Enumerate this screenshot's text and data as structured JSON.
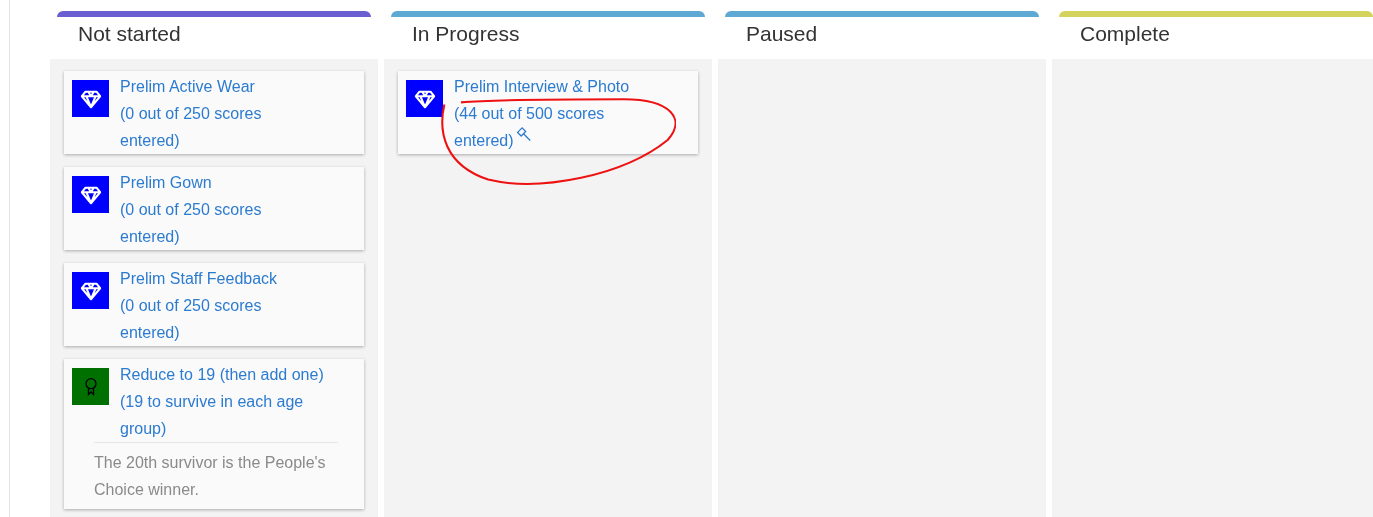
{
  "columns": [
    {
      "title": "Not started",
      "color": "#6a5fd0",
      "cards": [
        {
          "kind": "diamond",
          "title": "Prelim Active Wear",
          "detail": "(0 out of 250 scores entered)",
          "editing": false,
          "circled": false
        },
        {
          "kind": "diamond",
          "title": "Prelim Gown",
          "detail": "(0 out of 250 scores entered)",
          "editing": false,
          "circled": false
        },
        {
          "kind": "diamond",
          "title": "Prelim Staff Feedback",
          "detail": "(0 out of 250 scores entered)",
          "editing": false,
          "circled": false
        },
        {
          "kind": "award",
          "title": "Reduce to 19 (then add one) (19 to survive in each age group)",
          "note": "The 20th survivor is the People's Choice winner.",
          "circled": false
        }
      ]
    },
    {
      "title": "In Progress",
      "color": "#5ea8d4",
      "cards": [
        {
          "kind": "diamond",
          "title": "Prelim Interview & Photo",
          "detail": "(44 out of 500 scores entered)",
          "editing": true,
          "circled": true
        }
      ]
    },
    {
      "title": "Paused",
      "color": "#5ea8d4"
    },
    {
      "title": "Complete",
      "color": "#d3d35e"
    }
  ]
}
